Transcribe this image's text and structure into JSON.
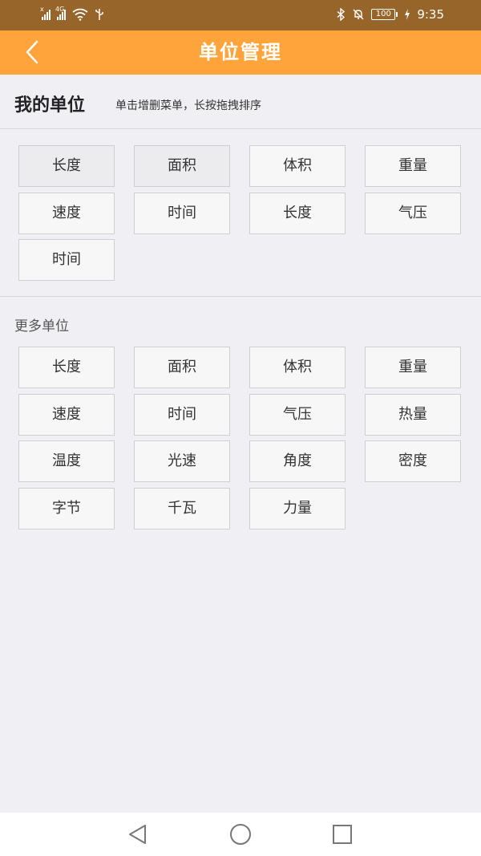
{
  "status_bar": {
    "network_1": "x",
    "network_2": "4G",
    "battery": "100",
    "time": "9:35"
  },
  "header": {
    "title": "单位管理"
  },
  "my_units": {
    "title": "我的单位",
    "hint": "单击增删菜单，长按拖拽排序",
    "items": [
      {
        "label": "长度",
        "pressed": true
      },
      {
        "label": "面积",
        "pressed": true
      },
      {
        "label": "体积",
        "pressed": false
      },
      {
        "label": "重量",
        "pressed": false
      },
      {
        "label": "速度",
        "pressed": false
      },
      {
        "label": "时间",
        "pressed": false
      },
      {
        "label": "长度",
        "pressed": false
      },
      {
        "label": "气压",
        "pressed": false
      },
      {
        "label": "时间",
        "pressed": false
      }
    ]
  },
  "more_units": {
    "title": "更多单位",
    "items": [
      {
        "label": "长度"
      },
      {
        "label": "面积"
      },
      {
        "label": "体积"
      },
      {
        "label": "重量"
      },
      {
        "label": "速度"
      },
      {
        "label": "时间"
      },
      {
        "label": "气压"
      },
      {
        "label": "热量"
      },
      {
        "label": "温度"
      },
      {
        "label": "光速"
      },
      {
        "label": "角度"
      },
      {
        "label": "密度"
      },
      {
        "label": "字节"
      },
      {
        "label": "千瓦"
      },
      {
        "label": "力量"
      }
    ]
  },
  "colors": {
    "status_bar": "#97652a",
    "header": "#ffa43a",
    "background": "#efeff4"
  },
  "icons": {
    "back": "chevron-left-icon",
    "nav_back": "triangle-back-icon",
    "nav_home": "circle-home-icon",
    "nav_recent": "square-recent-icon"
  }
}
